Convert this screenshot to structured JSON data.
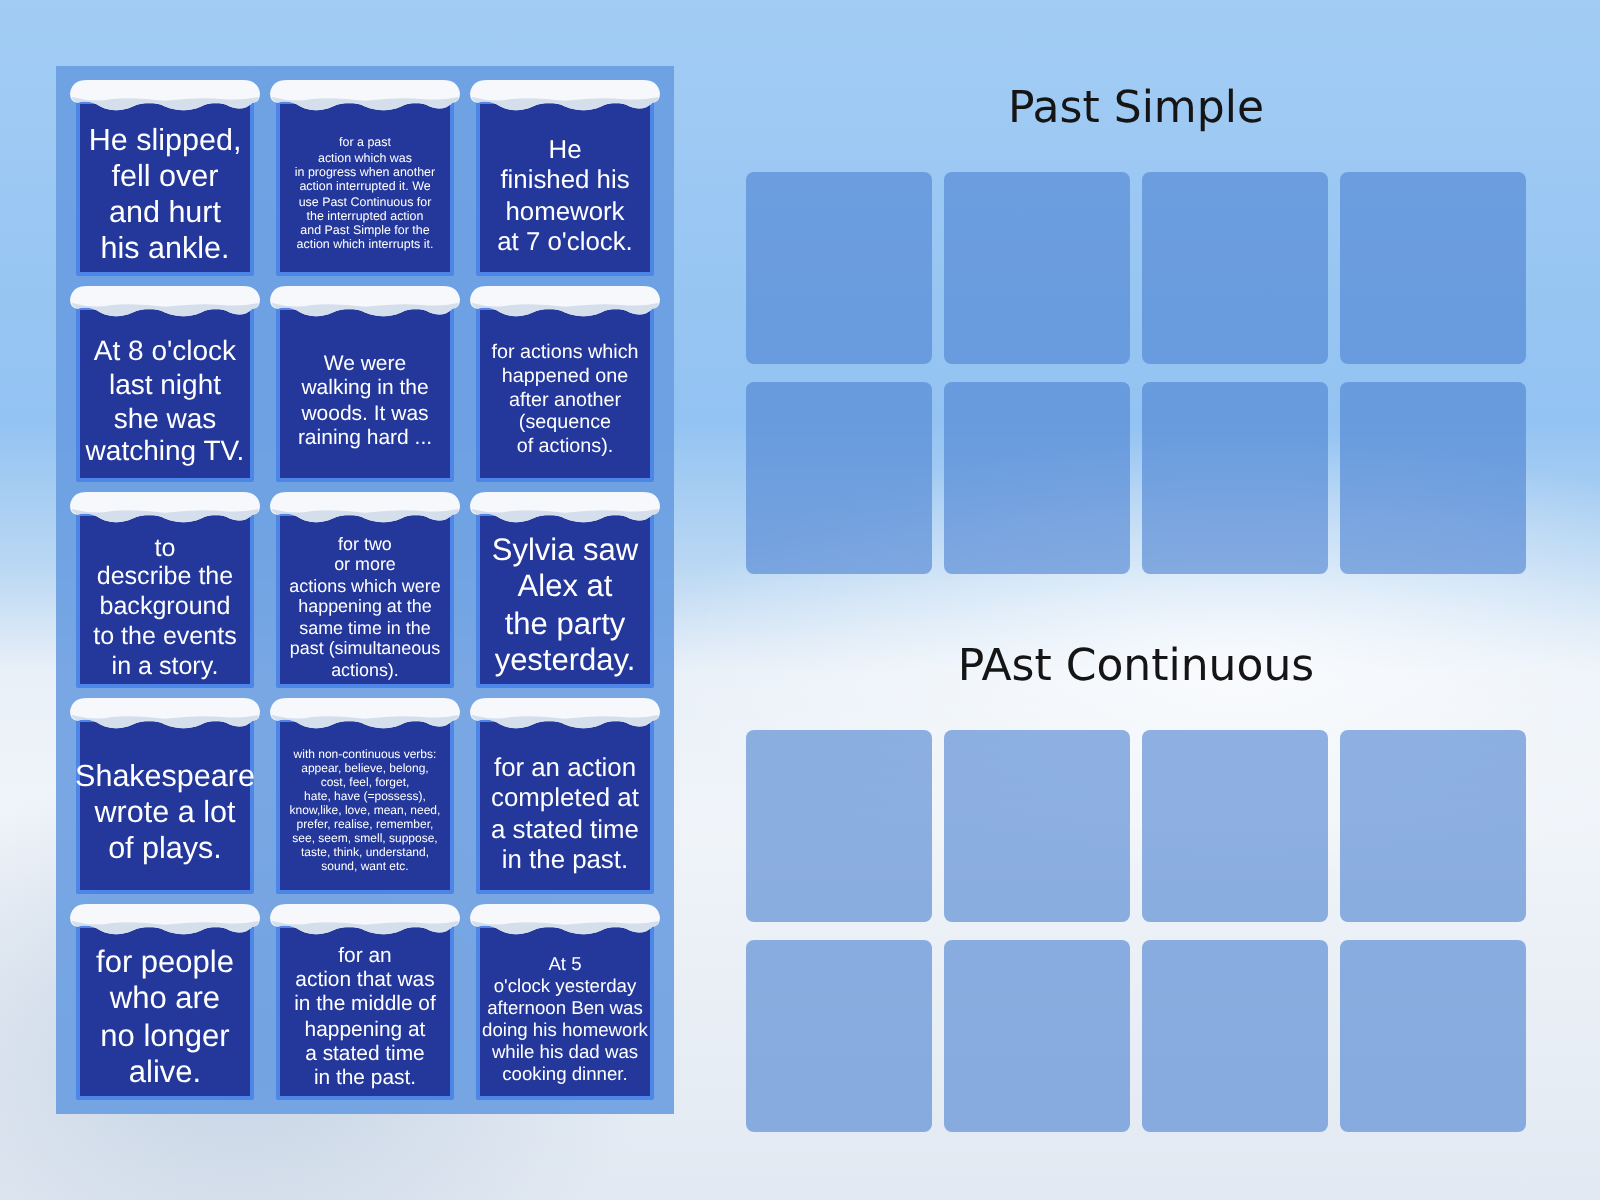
{
  "card_tray": {
    "cards": [
      {
        "text": "He slipped,\nfell over\nand hurt\nhis ankle."
      },
      {
        "text": "for a past\naction which was\nin progress when another\naction interrupted it. We\nuse Past Continuous for\nthe interrupted action\nand Past Simple for the\naction which interrupts it."
      },
      {
        "text": "He\nfinished his\nhomework\nat 7 o'clock."
      },
      {
        "text": "At 8 o'clock\nlast night\nshe was\nwatching TV."
      },
      {
        "text": "We were\nwalking in the\nwoods. It was\nraining hard ..."
      },
      {
        "text": "for actions which\nhappened one\nafter another\n(sequence\nof actions)."
      },
      {
        "text": "to\ndescribe the\nbackground\nto the events\nin a story."
      },
      {
        "text": "for two\nor more\nactions which were\nhappening at the\nsame time in the\npast (simultaneous\nactions)."
      },
      {
        "text": "Sylvia saw\nAlex at\nthe party\nyesterday."
      },
      {
        "text": "Shakespeare\nwrote a lot\nof plays."
      },
      {
        "text": "with non-continuous verbs:\nappear, believe, belong,\ncost, feel, forget,\nhate, have (=possess),\nknow,like, love, mean, need,\nprefer, realise, remember,\nsee, seem, smell, suppose,\ntaste, think, understand,\nsound, want etc."
      },
      {
        "text": "for an action\ncompleted at\na stated time\nin the past."
      },
      {
        "text": "for people\nwho are\nno longer\nalive."
      },
      {
        "text": "for an\naction that was\nin the middle of\nhappening at\na stated time\nin the past."
      },
      {
        "text": "At 5\no'clock yesterday\nafternoon Ben was\ndoing his homework\nwhile his dad was\ncooking dinner."
      }
    ]
  },
  "groups": [
    {
      "title": "Past Simple"
    },
    {
      "title": "PAst Continuous"
    }
  ]
}
